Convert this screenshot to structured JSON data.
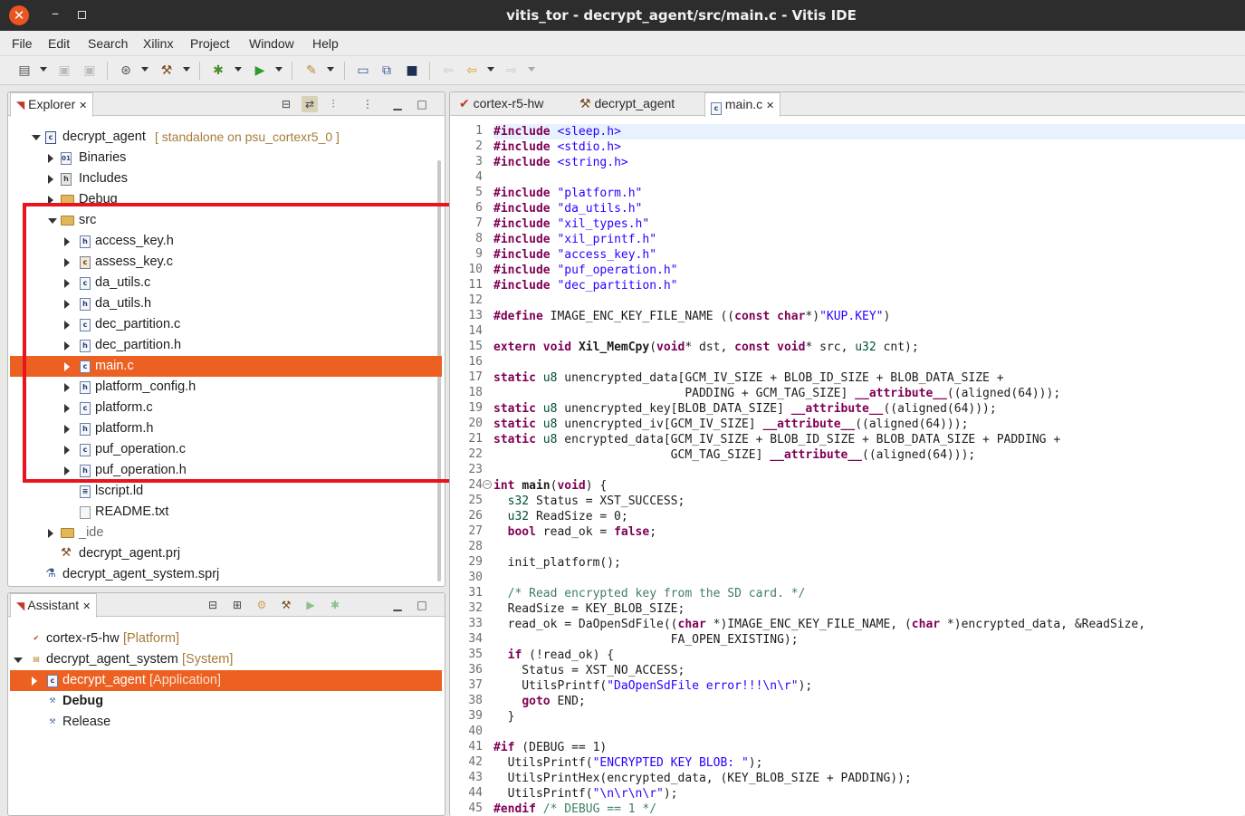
{
  "window": {
    "title": "vitis_tor - decrypt_agent/src/main.c - Vitis IDE"
  },
  "menu": [
    "File",
    "Edit",
    "Search",
    "Xilinx",
    "Project",
    "Window",
    "Help"
  ],
  "explorer": {
    "tab_label": "Explorer",
    "project": {
      "name": "decrypt_agent",
      "decoration": "[ standalone on psu_cortexr5_0 ]"
    },
    "items": [
      {
        "label": "Binaries"
      },
      {
        "label": "Includes"
      },
      {
        "label": "Debug"
      },
      {
        "label": "src"
      },
      {
        "label": "access_key.h"
      },
      {
        "label": "assess_key.c"
      },
      {
        "label": "da_utils.c"
      },
      {
        "label": "da_utils.h"
      },
      {
        "label": "dec_partition.c"
      },
      {
        "label": "dec_partition.h"
      },
      {
        "label": "main.c"
      },
      {
        "label": "platform_config.h"
      },
      {
        "label": "platform.c"
      },
      {
        "label": "platform.h"
      },
      {
        "label": "puf_operation.c"
      },
      {
        "label": "puf_operation.h"
      },
      {
        "label": "lscript.ld"
      },
      {
        "label": "README.txt"
      },
      {
        "label": "_ide"
      },
      {
        "label": "decrypt_agent.prj"
      },
      {
        "label": "decrypt_agent_system.sprj"
      }
    ],
    "selected": "main.c"
  },
  "assistant": {
    "tab_label": "Assistant",
    "items": [
      {
        "label": "cortex-r5-hw",
        "decoration": "[Platform]"
      },
      {
        "label": "decrypt_agent_system",
        "decoration": "[System]"
      },
      {
        "label": "decrypt_agent",
        "decoration": "[Application]"
      },
      {
        "label": "Debug"
      },
      {
        "label": "Release"
      }
    ]
  },
  "editor": {
    "tabs": [
      {
        "label": "cortex-r5-hw"
      },
      {
        "label": "decrypt_agent"
      },
      {
        "label": "main.c"
      }
    ],
    "active_tab": "main.c",
    "lines": [
      "#include <sleep.h>",
      "#include <stdio.h>",
      "#include <string.h>",
      "",
      "#include \"platform.h\"",
      "#include \"da_utils.h\"",
      "#include \"xil_types.h\"",
      "#include \"xil_printf.h\"",
      "#include \"access_key.h\"",
      "#include \"puf_operation.h\"",
      "#include \"dec_partition.h\"",
      "",
      "#define IMAGE_ENC_KEY_FILE_NAME ((const char*)\"KUP.KEY\")",
      "",
      "extern void Xil_MemCpy(void* dst, const void* src, u32 cnt);",
      "",
      "static u8 unencrypted_data[GCM_IV_SIZE + BLOB_ID_SIZE + BLOB_DATA_SIZE +",
      "                           PADDING + GCM_TAG_SIZE] __attribute__((aligned(64)));",
      "static u8 unencrypted_key[BLOB_DATA_SIZE] __attribute__((aligned(64)));",
      "static u8 unencrypted_iv[GCM_IV_SIZE] __attribute__((aligned(64)));",
      "static u8 encrypted_data[GCM_IV_SIZE + BLOB_ID_SIZE + BLOB_DATA_SIZE + PADDING +",
      "                         GCM_TAG_SIZE] __attribute__((aligned(64)));",
      "",
      "int main(void) {",
      "  s32 Status = XST_SUCCESS;",
      "  u32 ReadSize = 0;",
      "  bool read_ok = false;",
      "",
      "  init_platform();",
      "",
      "  /* Read encrypted key from the SD card. */",
      "  ReadSize = KEY_BLOB_SIZE;",
      "  read_ok = DaOpenSdFile((char *)IMAGE_ENC_KEY_FILE_NAME, (char *)encrypted_data, &ReadSize,",
      "                         FA_OPEN_EXISTING);",
      "  if (!read_ok) {",
      "    Status = XST_NO_ACCESS;",
      "    UtilsPrintf(\"DaOpenSdFile error!!!\\n\\r\");",
      "    goto END;",
      "  }",
      "",
      "#if (DEBUG == 1)",
      "  UtilsPrintf(\"ENCRYPTED KEY BLOB: \");",
      "  UtilsPrintHex(encrypted_data, (KEY_BLOB_SIZE + PADDING));",
      "  UtilsPrintf(\"\\n\\r\\n\\r\");",
      "#endif /* DEBUG == 1 */"
    ]
  },
  "colors": {
    "selection": "#ec6022",
    "highlight_box": "#e8141e",
    "keyword": "#7f0055",
    "string": "#2a00ff",
    "comment": "#3f7f5f"
  }
}
